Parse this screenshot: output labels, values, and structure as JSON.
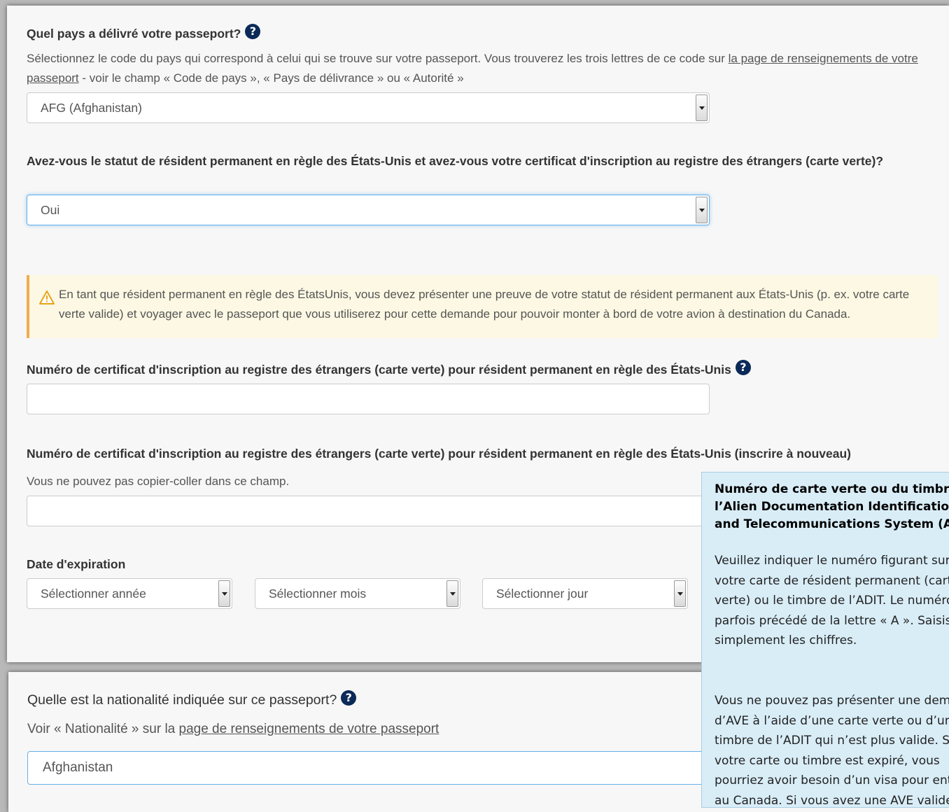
{
  "passport_country": {
    "question": "Quel pays a délivré votre passeport?",
    "help_icon": "question-circle-icon",
    "instructions_before_link": "Sélectionnez le code du pays qui correspond à celui qui se trouve sur votre passeport. Vous trouverez les trois lettres de ce code sur ",
    "instructions_link": "la page de renseignements de votre passeport",
    "instructions_after_link": " - voir le champ « Code de pays », « Pays de délivrance » ou « Autorité »",
    "selected": "AFG (Afghanistan)"
  },
  "green_card_status": {
    "question": "Avez-vous le statut de résident permanent en règle des États-Unis et avez-vous votre certificat d'inscription au registre des étrangers (carte verte)?",
    "selected": "Oui"
  },
  "alert": {
    "icon": "warning-triangle-icon",
    "text": "En tant que résident permanent en règle des ÉtatsUnis, vous devez présenter une preuve de votre statut de résident permanent aux États-Unis (p. ex. votre carte verte valide) et voyager avec le passeport que vous utiliserez pour cette demande pour pouvoir monter à bord de votre avion à destination du Canada."
  },
  "green_card_number": {
    "label": "Numéro de certificat d'inscription au registre des étrangers (carte verte) pour résident permanent en règle des États-Unis",
    "value": ""
  },
  "green_card_number_confirm": {
    "label": "Numéro de certificat d'inscription au registre des étrangers (carte verte) pour résident permanent en règle des États-Unis (inscrire à nouveau)",
    "note": "Vous ne pouvez pas copier-coller dans ce champ.",
    "value": ""
  },
  "expiry_date": {
    "label": "Date d'expiration",
    "year_placeholder": "Sélectionner année",
    "month_placeholder": "Sélectionner mois",
    "day_placeholder": "Sélectionner jour"
  },
  "nationality": {
    "question": "Quelle est la nationalité indiquée sur ce passeport?",
    "instructions_before_link": "Voir « Nationalité » sur la ",
    "instructions_link": "page de renseignements de votre passeport",
    "selected": "Afghanistan"
  },
  "tooltip": {
    "title": "Numéro de carte verte ou du timbre de l’Alien Documentation Identification and Telecommunications System (ADIT)",
    "paragraph1": "Veuillez indiquer le numéro figurant sur votre carte de résident permanent (carte verte) ou le timbre de l’ADIT. Le numéro est parfois précédé de la lettre « A ». Saisissez simplement les chiffres.",
    "paragraph2": "Vous ne pouvez pas présenter une demande d’AVE à l’aide d’une carte verte ou d’un timbre de l’ADIT qui n’est plus valide. Si votre carte ou timbre est expiré, vous pourriez avoir besoin d’un visa pour entrer au Canada. Si vous avez une AVE valide, mais que votre carte verte ou votre"
  }
}
